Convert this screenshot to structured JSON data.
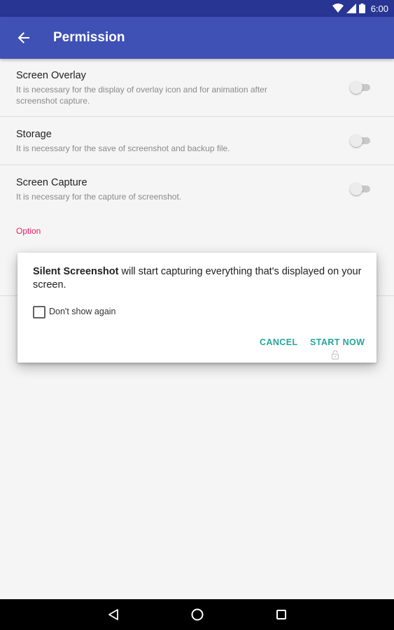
{
  "status_bar": {
    "time": "6:00",
    "icons": [
      "wifi-icon",
      "signal-icon",
      "battery-icon"
    ]
  },
  "app_bar": {
    "title": "Permission",
    "back_icon": "arrow-back-icon",
    "color": "#3f51b5"
  },
  "permissions": [
    {
      "title": "Screen Overlay",
      "description": "It is necessary for the display of overlay icon and for animation after screenshot capture.",
      "enabled": false
    },
    {
      "title": "Storage",
      "description": "It is necessary for the save of screenshot and backup file.",
      "enabled": false
    },
    {
      "title": "Screen Capture",
      "description": "It is necessary for the capture of screenshot.",
      "enabled": false
    }
  ],
  "option_section": {
    "label": "Option",
    "color": "#e91e63"
  },
  "dialog": {
    "message_bold": "Silent Screenshot",
    "message_rest": " will start capturing everything that's displayed on your screen.",
    "checkbox_label": "Don't show again",
    "checkbox_checked": false,
    "cancel_label": "CANCEL",
    "start_label": "START NOW",
    "button_color": "#26a69a"
  },
  "nav_bar": {
    "buttons": [
      "back-icon",
      "home-icon",
      "recents-icon"
    ]
  }
}
